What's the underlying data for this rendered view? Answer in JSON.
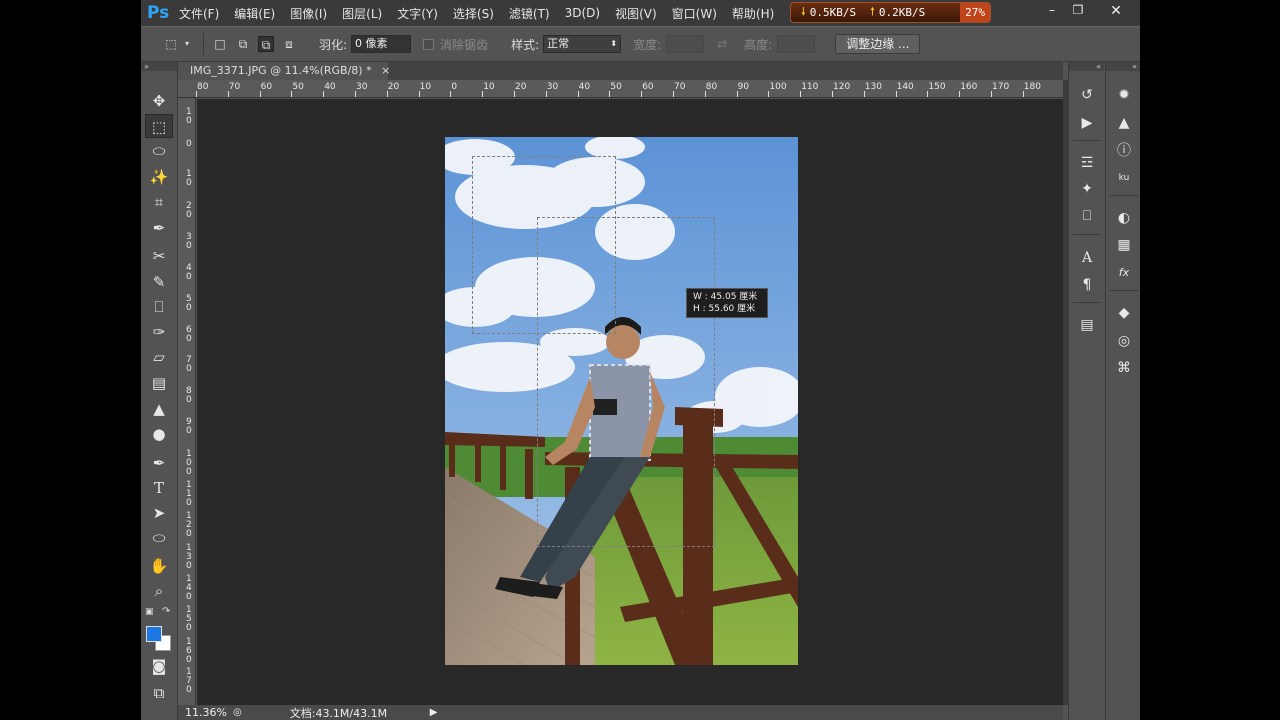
{
  "menubar": {
    "logo": "Ps",
    "items": [
      "文件(F)",
      "编辑(E)",
      "图像(I)",
      "图层(L)",
      "文字(Y)",
      "选择(S)",
      "滤镜(T)",
      "3D(D)",
      "视图(V)",
      "窗口(W)",
      "帮助(H)"
    ]
  },
  "netmon": {
    "down": "0.5KB/S",
    "up": "0.2KB/S",
    "cpu": "27%"
  },
  "options": {
    "feather_label": "羽化:",
    "feather_value": "0 像素",
    "antialias_label": "消除锯齿",
    "style_label": "样式:",
    "style_value": "正常",
    "width_label": "宽度:",
    "height_label": "高度:",
    "refine_label": "调整边缘 ..."
  },
  "document": {
    "tab_title": "IMG_3371.JPG @ 11.4%(RGB/8) *",
    "tab_close": "×"
  },
  "rulers": {
    "top": [
      "80",
      "70",
      "60",
      "50",
      "40",
      "30",
      "20",
      "10",
      "0",
      "10",
      "20",
      "30",
      "40",
      "50",
      "60",
      "70",
      "80",
      "90",
      "100",
      "110",
      "120",
      "130",
      "140",
      "150",
      "160",
      "170",
      "180"
    ],
    "left": [
      "1\n0",
      "0",
      "1\n0",
      "2\n0",
      "3\n0",
      "4\n0",
      "5\n0",
      "6\n0",
      "7\n0",
      "8\n0",
      "9\n0",
      "1\n0\n0",
      "1\n1\n0",
      "1\n2\n0",
      "1\n3\n0",
      "1\n4\n0",
      "1\n5\n0",
      "1\n6\n0",
      "1\n7\n0"
    ]
  },
  "tooltip": {
    "w": "W :  45.05  厘米",
    "h": "H :  55.60  厘米"
  },
  "status": {
    "zoom": "11.36%",
    "doc": "文档:43.1M/43.1M"
  },
  "colors": {
    "foreground": "#1e78e4",
    "background": "#ffffff",
    "accent": "#2fa3f5"
  },
  "tools": [
    "move-icon",
    "rect-marquee-icon",
    "lasso-icon",
    "magic-wand-icon",
    "crop-icon",
    "eyedropper-icon",
    "healing-icon",
    "brush-icon",
    "stamp-icon",
    "history-brush-icon",
    "eraser-icon",
    "gradient-icon",
    "blur-icon",
    "dodge-icon",
    "pen-icon",
    "type-icon",
    "path-select-icon",
    "ellipse-icon",
    "hand-icon",
    "zoom-icon"
  ]
}
